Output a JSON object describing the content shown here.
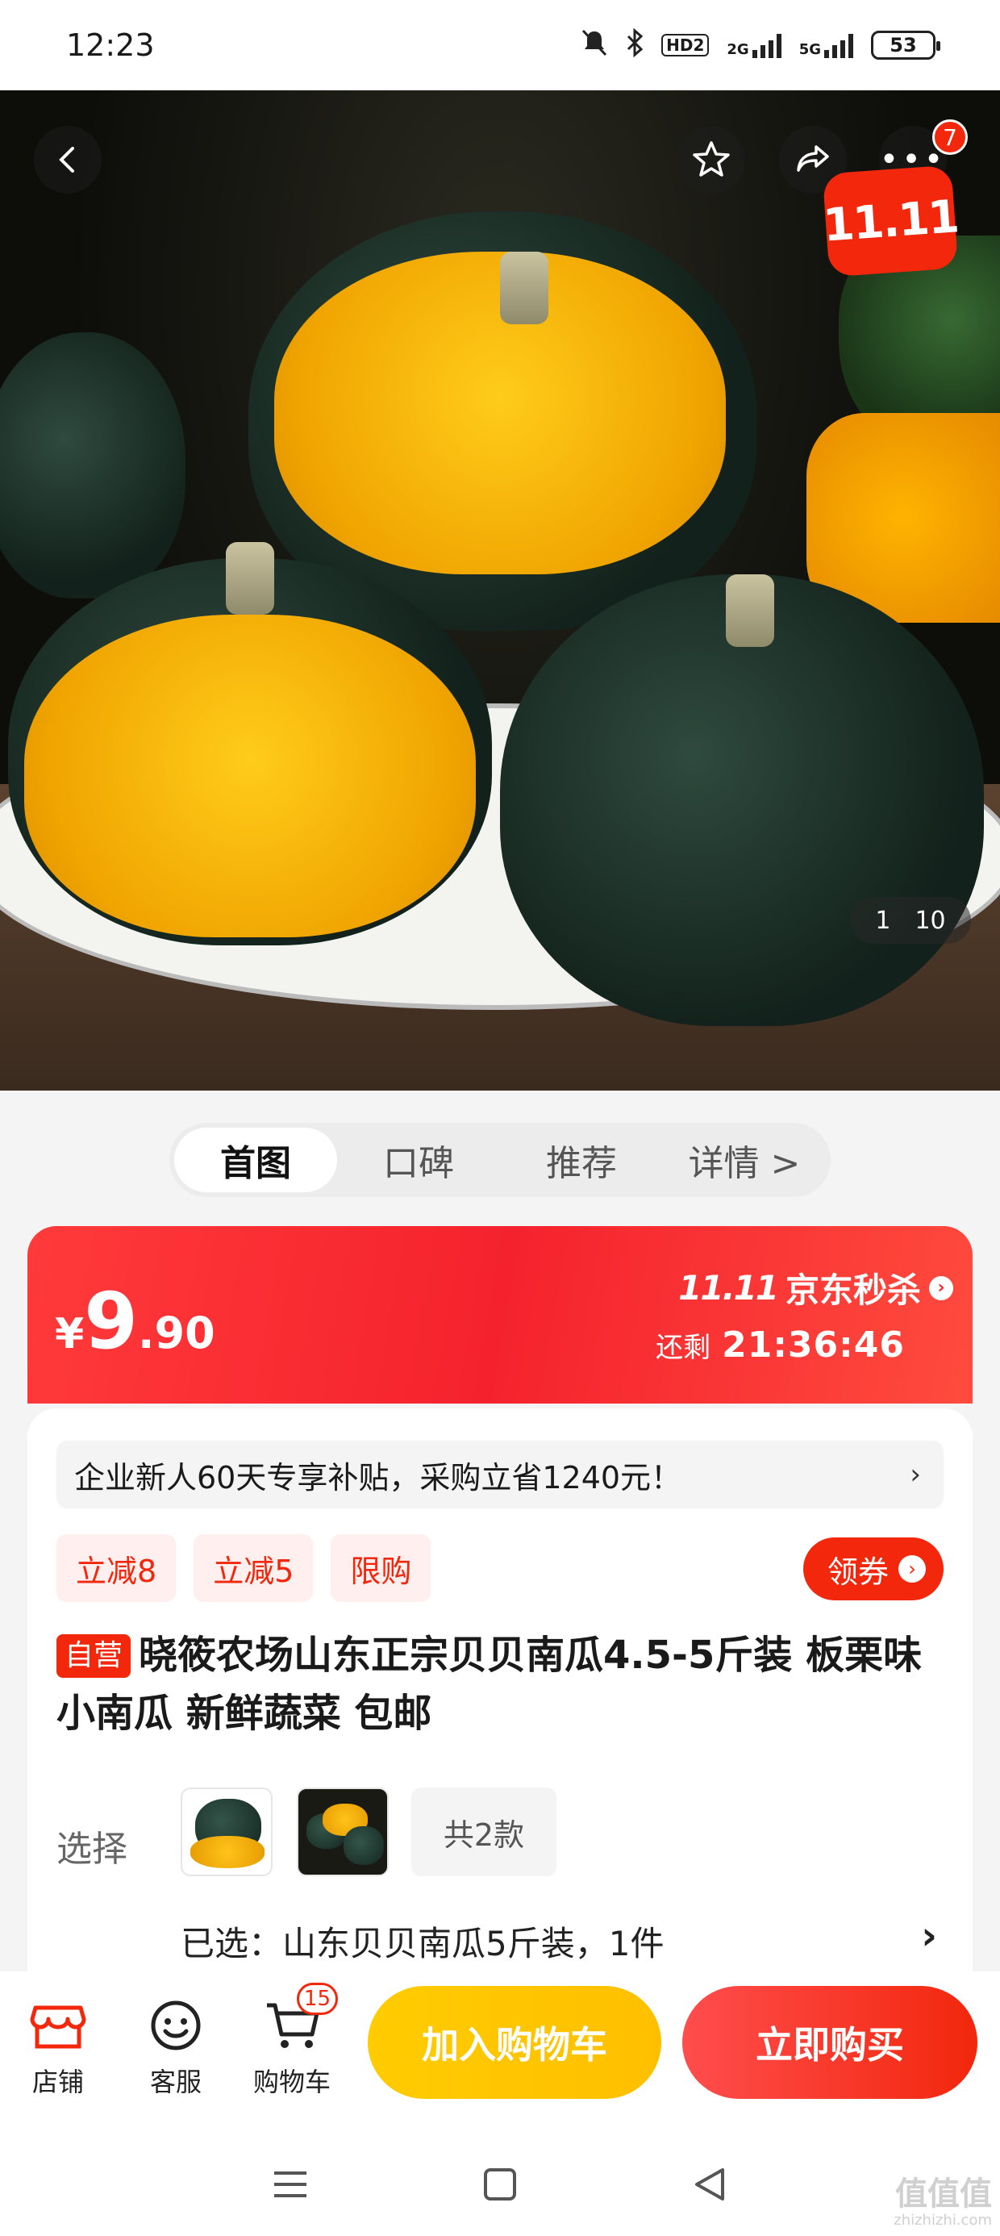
{
  "status_bar": {
    "time": "12:23",
    "net1": "2G",
    "net2": "5G",
    "battery": "53",
    "hd": "HD2"
  },
  "hero": {
    "more_badge": "7",
    "promo_badge": "11.11",
    "pager_current": "1",
    "pager_total": "10"
  },
  "tabs": [
    {
      "label": "首图"
    },
    {
      "label": "口碑"
    },
    {
      "label": "推荐"
    },
    {
      "label": "详情 >"
    }
  ],
  "price": {
    "currency": "¥",
    "integer": "9",
    "decimal": ".90"
  },
  "seckill": {
    "event": "11.11",
    "label": "京东秒杀",
    "countdown_label": "还剩",
    "countdown": "21:36:46"
  },
  "banner": {
    "text": "企业新人60天专享补贴，采购立省1240元！",
    "chevron": "›"
  },
  "tags": [
    "立减8",
    "立减5",
    "限购"
  ],
  "coupon": {
    "label": "领券"
  },
  "product": {
    "self_operated": "自营",
    "title": "晓筱农场山东正宗贝贝南瓜4.5-5斤装 板栗味小南瓜 新鲜蔬菜 包邮"
  },
  "selection": {
    "label": "选择",
    "count": "共2款",
    "selected_text": "已选：山东贝贝南瓜5斤装，1件",
    "chevron": "›"
  },
  "bottom_bar": {
    "store": "店铺",
    "service": "客服",
    "cart": "购物车",
    "cart_badge": "15",
    "add_to_cart": "加入购物车",
    "buy_now": "立即购买"
  },
  "watermark": {
    "logo": "值值值",
    "url": "zhizhizhi.com"
  },
  "colors": {
    "accent_red": "#f2270c",
    "accent_yellow": "#ffcc00"
  }
}
